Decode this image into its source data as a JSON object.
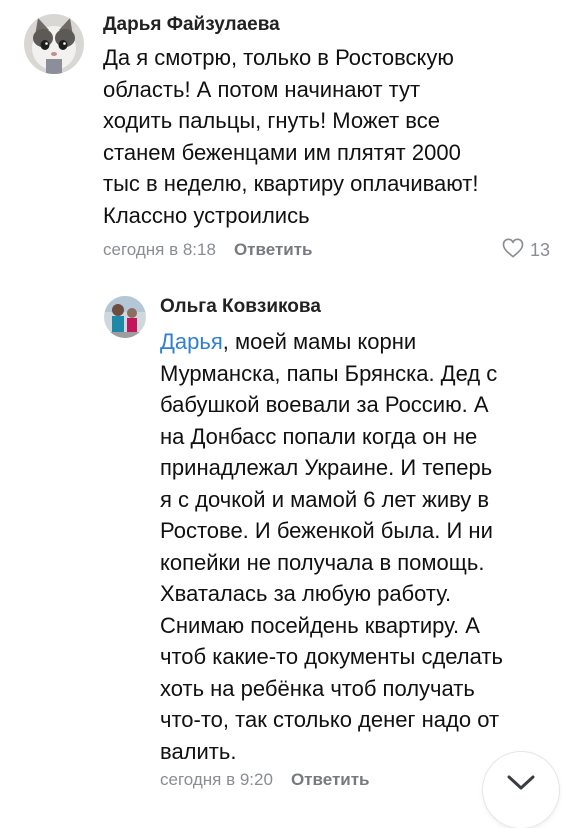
{
  "comments": [
    {
      "author": "Дарья Файзулаева",
      "avatar_icon": "cat-avatar-icon",
      "lines": [
        "Да я смотрю, только в Ростовскую",
        "область! А потом начинают тут",
        "ходить пальцы, гнуть! Может все",
        "станем беженцами им плятят 2000",
        "тыс в неделю, квартиру оплачивают!",
        "Классно устроились"
      ],
      "time": "сегодня в 8:18",
      "reply_label": "Ответить",
      "likes": "13"
    },
    {
      "author": "Ольга Ковзикова",
      "avatar_icon": "person-photo-avatar-icon",
      "mention": "Дарья",
      "lines": [
        ", моей мамы корни",
        "Мурманска, папы Брянска. Дед с",
        "бабушкой воевали за Россию. А",
        "на Донбасс попали когда он не",
        "принадлежал Украине. И теперь",
        "я с дочкой и мамой 6 лет живу в",
        "Ростове. И беженкой была. И ни",
        "копейки не получала в помощь.",
        "Хваталась за любую работу.",
        "Снимаю посейдень квартиру. А",
        "чтоб какие-то документы сделать",
        "хоть на ребёнка чтоб получать",
        "что-то, так столько денег надо от",
        "валить."
      ],
      "time": "сегодня в 9:20",
      "reply_label": "Ответить"
    }
  ],
  "icons": {
    "like": "heart-outline-icon",
    "scroll": "chevron-down-icon"
  },
  "colors": {
    "mention": "#2f80d1",
    "meta": "#8a8d91"
  }
}
